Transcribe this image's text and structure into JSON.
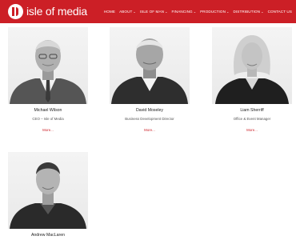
{
  "site": {
    "logo_text": "isle of media"
  },
  "nav": {
    "items": [
      {
        "label": "HOME",
        "has_dropdown": false
      },
      {
        "label": "ABOUT",
        "has_dropdown": true
      },
      {
        "label": "ISLE OF MAN",
        "has_dropdown": true
      },
      {
        "label": "FINANCING",
        "has_dropdown": true
      },
      {
        "label": "PRODUCTION",
        "has_dropdown": true
      },
      {
        "label": "DISTRIBUTION",
        "has_dropdown": true
      },
      {
        "label": "CONTACT US",
        "has_dropdown": false
      }
    ],
    "dropdown_glyph": "⌄"
  },
  "team": [
    {
      "name": "Michael Wilson",
      "role": "CEO – Isle of Media",
      "more": "More..."
    },
    {
      "name": "David Moseley",
      "role": "Business Development Director",
      "more": "More..."
    },
    {
      "name": "Liam Sherriff",
      "role": "Office & Event Manager",
      "more": "More..."
    },
    {
      "name": "Andrew MacLaren",
      "role": "",
      "more": ""
    }
  ],
  "colors": {
    "brand_red": "#cc1f26",
    "link_red": "#cc1f26"
  },
  "icons": {
    "logo": "isle-of-media-logo-mark",
    "dropdown": "chevron-down-icon"
  }
}
